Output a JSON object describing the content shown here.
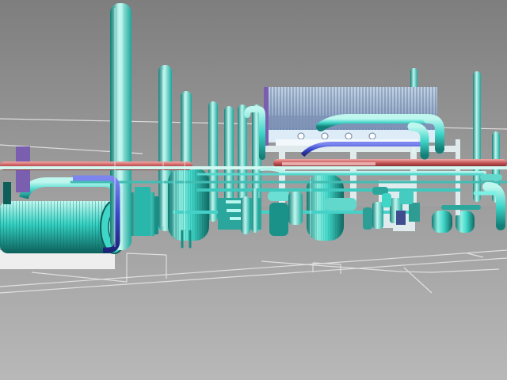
{
  "scene": {
    "colors": {
      "sky_top": "#7e7e7e",
      "sky_bottom": "#a9a9a9",
      "floor_top": "#9e9e9e",
      "floor_bottom": "#b8b8b8",
      "grid_line": "#e6e6e6",
      "pipe_main": "#3fd6c8",
      "pipe_dark": "#147f78",
      "pipe_light": "#bff7ef",
      "hot_pipe": "#c6585a",
      "hot_pipe_light": "#f2a7a5",
      "blue_pipe": "#3848c8",
      "purple_panel": "#7a5fb0",
      "equipment_blue": "#6f88b0",
      "white_structure": "#e8f4f6",
      "cyan_accent": "#1fc7d2"
    },
    "objects": [
      "heat-exchanger",
      "vertical-columns",
      "storage-tank",
      "air-cooler",
      "hot-process-pipe",
      "floor-gridlines",
      "pumps"
    ]
  }
}
